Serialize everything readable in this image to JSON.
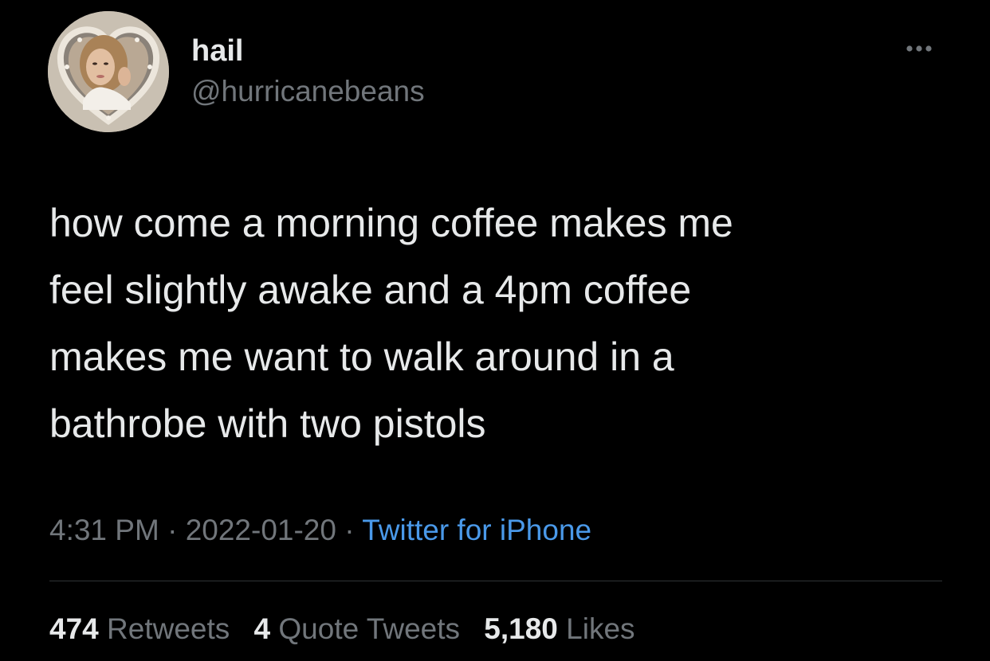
{
  "author": {
    "name": "hail",
    "handle": "@hurricanebeans"
  },
  "tweet": {
    "text": "how come a morning coffee makes me\nfeel slightly awake and a 4pm coffee\nmakes me want to walk around in a\nbathrobe with two pistols",
    "time": "4:31 PM",
    "separator": "·",
    "date": "2022-01-20",
    "source": "Twitter for iPhone"
  },
  "stats": {
    "retweets": {
      "count": "474",
      "label": "Retweets"
    },
    "quote_tweets": {
      "count": "4",
      "label": "Quote Tweets"
    },
    "likes": {
      "count": "5,180",
      "label": "Likes"
    }
  },
  "icons": {
    "more": "more-horizontal-icon",
    "avatar": "profile-photo"
  },
  "colors": {
    "background": "#000000",
    "primary_text": "#e7e9ea",
    "secondary_text": "#71767b",
    "link": "#4a99e9",
    "divider": "#2f3336"
  }
}
